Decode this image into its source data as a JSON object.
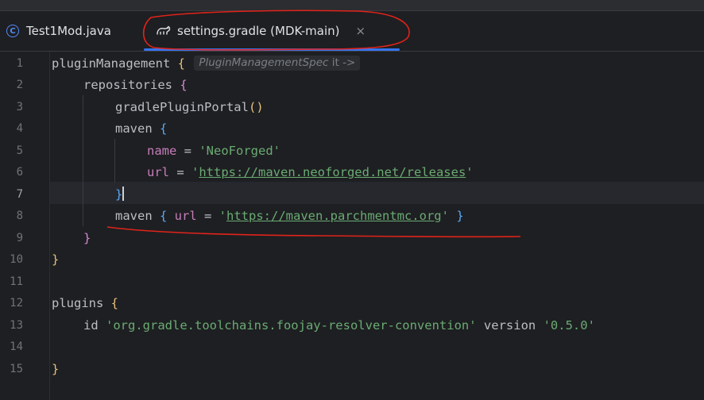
{
  "tabs": [
    {
      "label": "Test1Mod.java",
      "icon": "class-icon",
      "icon_glyph": "C",
      "active": false
    },
    {
      "label": "settings.gradle (MDK-main)",
      "icon": "gradle-elephant-icon",
      "active": true,
      "close_glyph": "×"
    }
  ],
  "gutter": {
    "line_numbers": [
      "1",
      "2",
      "3",
      "4",
      "5",
      "6",
      "7",
      "8",
      "9",
      "10",
      "11",
      "12",
      "13",
      "14",
      "15"
    ],
    "current_line": 7
  },
  "code": {
    "l1": {
      "ident": "pluginManagement ",
      "brace": "{",
      "hint_a": "PluginManagementSpec",
      "hint_b": " it ->"
    },
    "l2": {
      "ident": "repositories ",
      "brace": "{"
    },
    "l3": {
      "ident": "gradlePluginPortal",
      "parens": "()"
    },
    "l4": {
      "ident": "maven ",
      "brace": "{"
    },
    "l5": {
      "prop": "name",
      "eq": " = ",
      "value": "'NeoForged'"
    },
    "l6": {
      "prop": "url",
      "eq": " = ",
      "q1": "'",
      "url": "https://maven.neoforged.net/releases",
      "q2": "'"
    },
    "l7": {
      "brace": "}"
    },
    "l8": {
      "ident": "maven ",
      "brace_open": "{",
      "prop": " url",
      "eq": " = ",
      "q1": "'",
      "url": "https://maven.parchmentmc.org",
      "q2": "'",
      "brace_close": " }"
    },
    "l9": {
      "brace": "}"
    },
    "l10": {
      "brace": "}"
    },
    "l12": {
      "ident": "plugins ",
      "brace": "{"
    },
    "l13": {
      "ident": "id ",
      "value": "'org.gradle.toolchains.foojay-resolver-convention'",
      "ident2": " version ",
      "value2": "'0.5.0'"
    },
    "l15": {
      "brace": "}"
    }
  },
  "colors": {
    "background": "#1e1f22",
    "string": "#6aab73",
    "function": "#56a8f5",
    "property": "#c77dbb",
    "annotation_red": "#e0231b",
    "tab_underline": "#3574f0"
  }
}
